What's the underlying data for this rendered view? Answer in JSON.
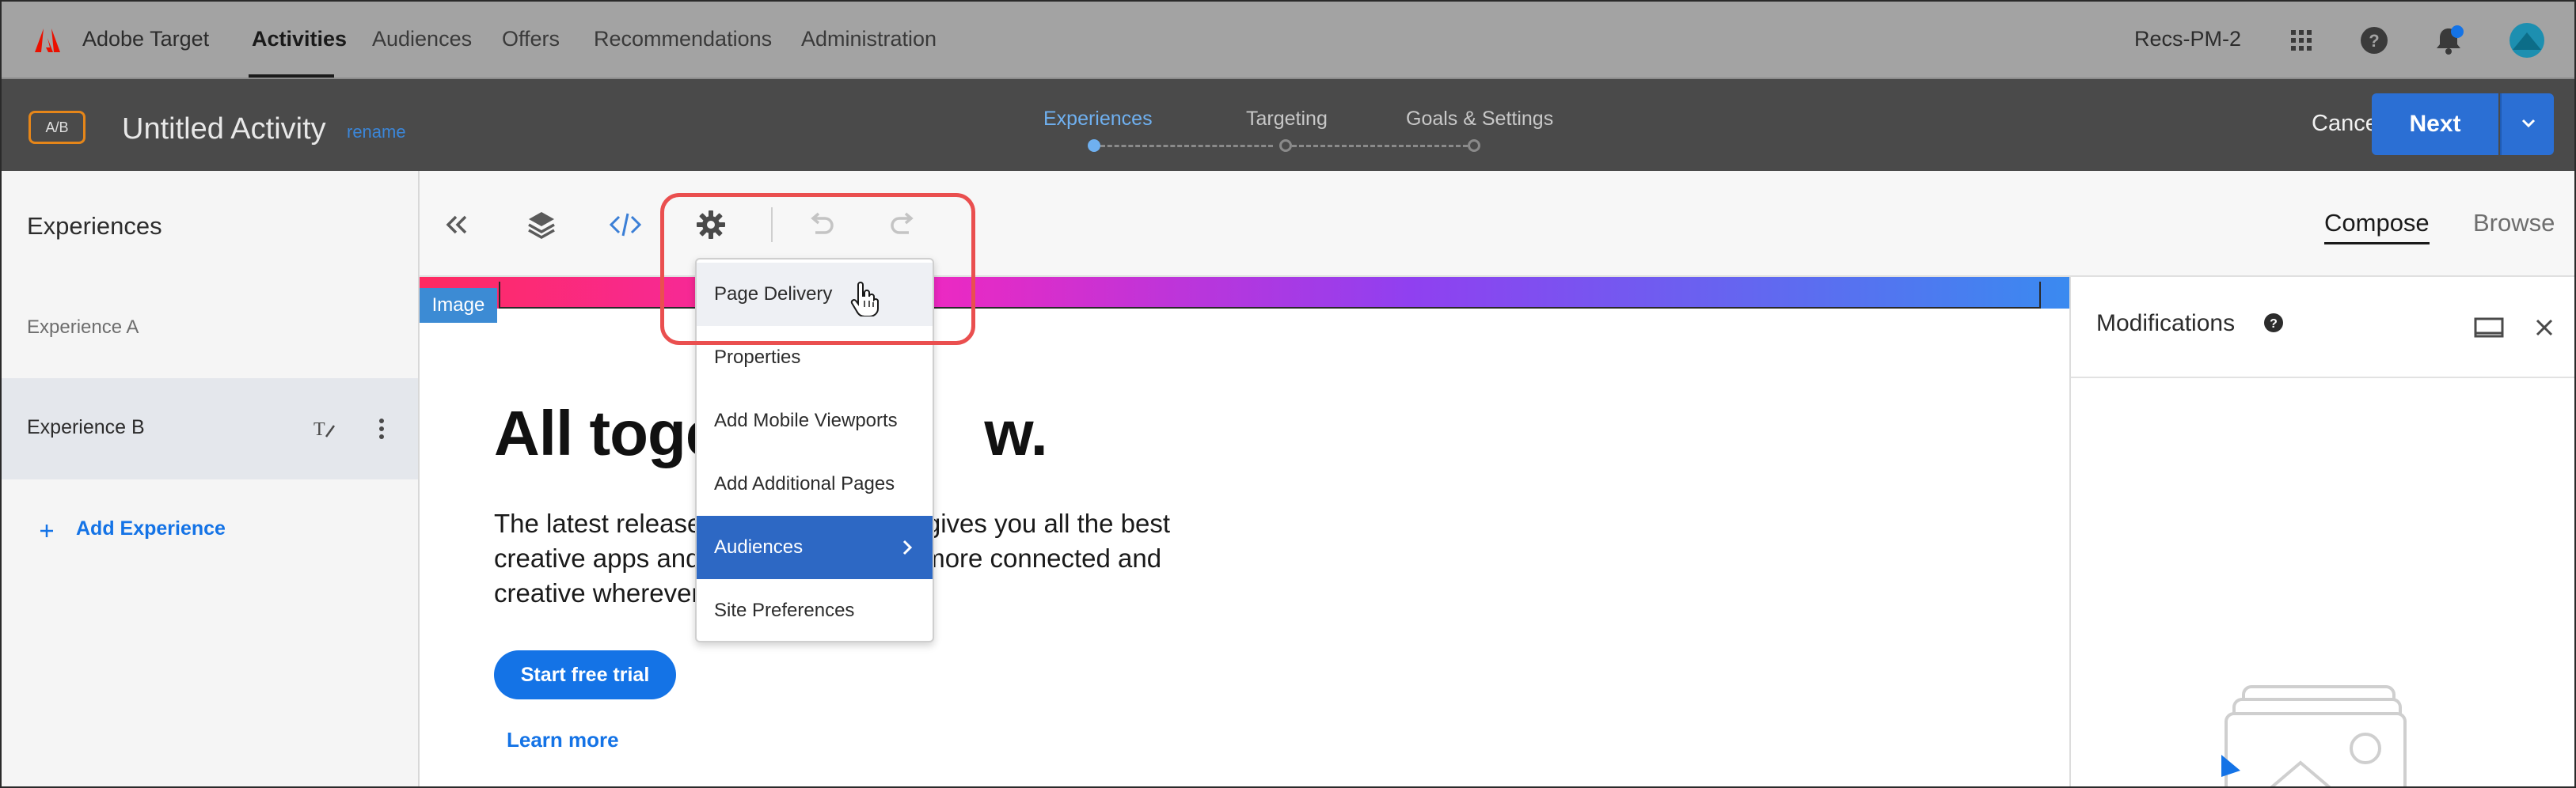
{
  "header": {
    "app_name": "Adobe Target",
    "nav": [
      {
        "label": "Activities",
        "active": true
      },
      {
        "label": "Audiences"
      },
      {
        "label": "Offers"
      },
      {
        "label": "Recommendations"
      },
      {
        "label": "Administration"
      }
    ],
    "org": "Recs-PM-2",
    "icons": [
      "apps-grid-icon",
      "help-icon",
      "notifications-bell-icon",
      "avatar"
    ],
    "brand_color": "#eb1000"
  },
  "activity": {
    "badge": "A/B",
    "title": "Untitled Activity",
    "rename_link": "rename",
    "steps": [
      {
        "label": "Experiences",
        "current": true
      },
      {
        "label": "Targeting"
      },
      {
        "label": "Goals & Settings"
      }
    ],
    "cancel_label": "Cancel",
    "next_label": "Next",
    "accent": "#2b6fd4"
  },
  "experiences": {
    "title": "Experiences",
    "items": [
      {
        "label": "Experience A"
      },
      {
        "label": "Experience B",
        "selected": true
      }
    ],
    "add_label": "Add Experience"
  },
  "toolbar": {
    "icons": [
      "collapse-icon",
      "layers-icon",
      "code-icon",
      "settings-gear-icon",
      "undo-icon",
      "redo-icon"
    ],
    "modes": [
      {
        "label": "Compose",
        "active": true
      },
      {
        "label": "Browse"
      }
    ]
  },
  "page": {
    "element_label": "Image",
    "headline": "All toge",
    "headline_tail": "w.",
    "body_lines": [
      {
        "a": "The latest release",
        "b": "loud gives you all the best"
      },
      {
        "a": "creative apps and",
        "b": "stay more connected and"
      },
      {
        "a": "creative wherever",
        "b": ""
      }
    ],
    "cta": "Start free trial",
    "learn_more": "Learn more"
  },
  "modifications": {
    "title": "Modifications"
  },
  "settings_menu": {
    "items": [
      {
        "label": "Page Delivery",
        "hover": true
      },
      {
        "label": "Properties"
      },
      {
        "label": "Add Mobile Viewports"
      },
      {
        "label": "Add Additional Pages"
      },
      {
        "label": "Audiences",
        "selected": true,
        "submenu": true
      },
      {
        "label": "Site Preferences"
      }
    ],
    "highlight_color": "#ea4f4f"
  }
}
